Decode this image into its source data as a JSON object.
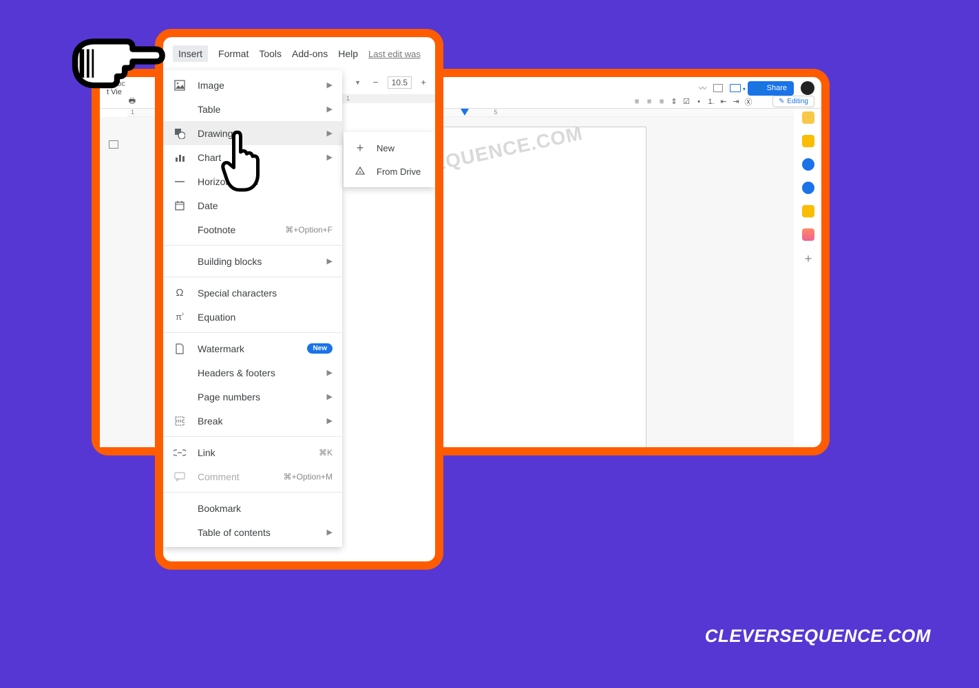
{
  "bg_color": "#5637d4",
  "accent_color": "#ff5c00",
  "primary_blue": "#1a73e8",
  "footer_text": "CLEVERSEQUENCE.COM",
  "back_window": {
    "doc_title_fragment": "d doc",
    "menu_fragment": "t   Vie",
    "share_label": "Share",
    "editing_label": "Editing",
    "font_size": "10.5",
    "watermark_text": "CLEVERSEQUENCE.COM",
    "ruler_labels": [
      "1",
      "5"
    ],
    "right_rail_colors": [
      "#fbbc04",
      "#34a853",
      "#1a73e8",
      "#fbbc04",
      "#ff8a65",
      "#888"
    ]
  },
  "menu_bar": {
    "items": [
      "Insert",
      "Format",
      "Tools",
      "Add-ons",
      "Help"
    ],
    "active_index": 0,
    "last_edit": "Last edit was"
  },
  "toolbar_snippet": {
    "dropdown_arrow": "▼",
    "minus": "−",
    "font_size": "10.5",
    "plus": "+"
  },
  "insert_menu": {
    "items": [
      {
        "icon": "image",
        "label": "Image",
        "arrow": true
      },
      {
        "icon": "",
        "label": "Table",
        "arrow": true
      },
      {
        "icon": "shapes",
        "label": "Drawing",
        "arrow": true,
        "highlight": true
      },
      {
        "icon": "chart",
        "label": "Chart",
        "arrow": true
      },
      {
        "icon": "line",
        "label": "Horizontal line"
      },
      {
        "icon": "date",
        "label": "Date"
      },
      {
        "icon": "",
        "label": "Footnote",
        "shortcut": "⌘+Option+F"
      },
      {
        "sep": true
      },
      {
        "icon": "",
        "label": "Building blocks",
        "arrow": true
      },
      {
        "sep": true
      },
      {
        "icon": "omega",
        "label": "Special characters"
      },
      {
        "icon": "pi",
        "label": "Equation"
      },
      {
        "sep": true
      },
      {
        "icon": "doc",
        "label": "Watermark",
        "badge": "New"
      },
      {
        "icon": "",
        "label": "Headers & footers",
        "arrow": true
      },
      {
        "icon": "",
        "label": "Page numbers",
        "arrow": true
      },
      {
        "icon": "break",
        "label": "Break",
        "arrow": true
      },
      {
        "sep": true
      },
      {
        "icon": "link",
        "label": "Link",
        "shortcut": "⌘K"
      },
      {
        "icon": "comment",
        "label": "Comment",
        "shortcut": "⌘+Option+M",
        "disabled": true
      },
      {
        "sep": true
      },
      {
        "icon": "",
        "label": "Bookmark"
      },
      {
        "icon": "",
        "label": "Table of contents",
        "arrow": true
      }
    ]
  },
  "drawing_submenu": {
    "items": [
      {
        "icon": "plus",
        "label": "New"
      },
      {
        "icon": "drive",
        "label": "From Drive"
      }
    ]
  }
}
